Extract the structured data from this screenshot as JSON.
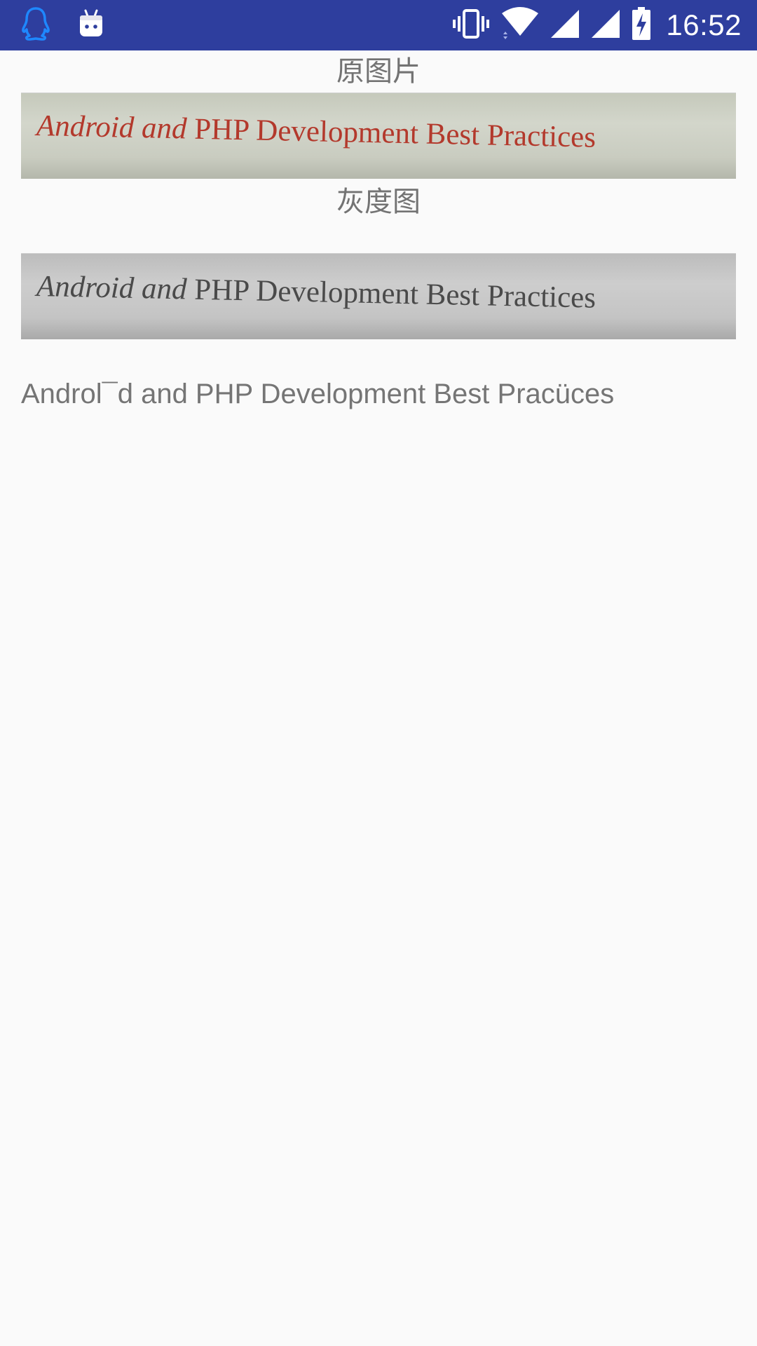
{
  "status_bar": {
    "time": "16:52",
    "icons": [
      "qq-icon",
      "android-robot-icon",
      "vibrate-icon",
      "wifi-icon",
      "cell-signal-icon",
      "cell-signal-icon",
      "battery-charging-icon"
    ],
    "background_color": "#2e3e9e"
  },
  "original_section": {
    "caption": "原图片",
    "image_text_part1": "Android and ",
    "image_text_part2": "PHP Development Best Practices"
  },
  "grayscale_section": {
    "caption": "灰度图",
    "image_text_part1": "Android and ",
    "image_text_part2": "PHP Development Best Practices"
  },
  "ocr_result": {
    "text": "Androl¯d and PHP Development Best Pracüces"
  },
  "colors": {
    "page_background": "#fafafa",
    "text_gray": "#737373",
    "photo_text_red": "#b3392c"
  }
}
